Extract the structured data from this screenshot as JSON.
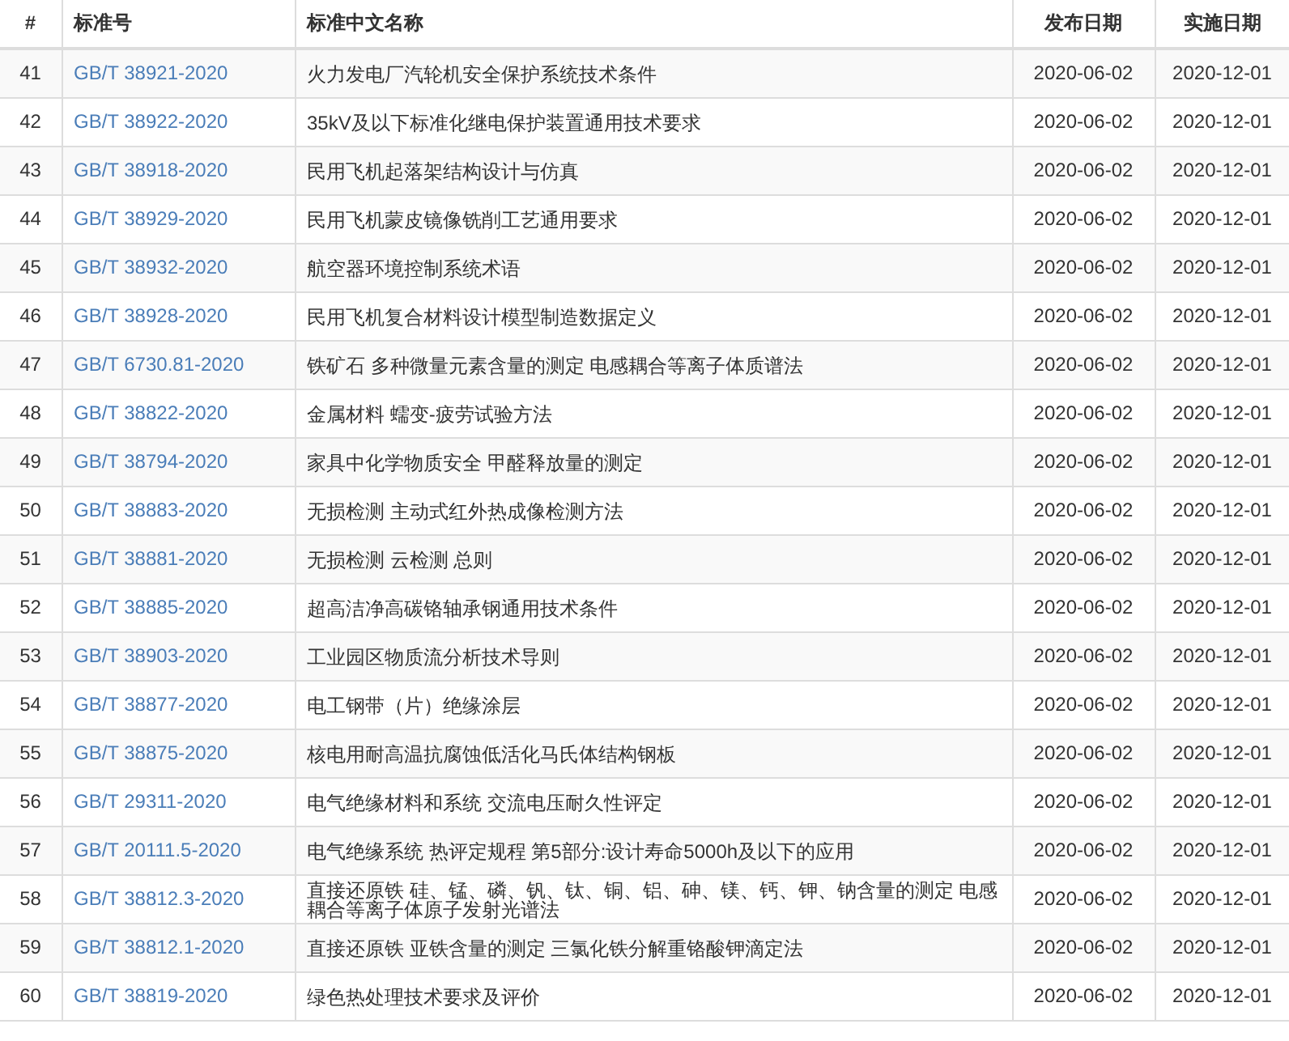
{
  "table": {
    "columns": [
      "#",
      "标准号",
      "标准中文名称",
      "发布日期",
      "实施日期"
    ],
    "rows": [
      {
        "index": "41",
        "code": "GB/T 38921-2020",
        "name": "火力发电厂汽轮机安全保护系统技术条件",
        "published": "2020-06-02",
        "effective": "2020-12-01"
      },
      {
        "index": "42",
        "code": "GB/T 38922-2020",
        "name": "35kV及以下标准化继电保护装置通用技术要求",
        "published": "2020-06-02",
        "effective": "2020-12-01"
      },
      {
        "index": "43",
        "code": "GB/T 38918-2020",
        "name": "民用飞机起落架结构设计与仿真",
        "published": "2020-06-02",
        "effective": "2020-12-01"
      },
      {
        "index": "44",
        "code": "GB/T 38929-2020",
        "name": "民用飞机蒙皮镜像铣削工艺通用要求",
        "published": "2020-06-02",
        "effective": "2020-12-01"
      },
      {
        "index": "45",
        "code": "GB/T 38932-2020",
        "name": "航空器环境控制系统术语",
        "published": "2020-06-02",
        "effective": "2020-12-01"
      },
      {
        "index": "46",
        "code": "GB/T 38928-2020",
        "name": "民用飞机复合材料设计模型制造数据定义",
        "published": "2020-06-02",
        "effective": "2020-12-01"
      },
      {
        "index": "47",
        "code": "GB/T 6730.81-2020",
        "name": "铁矿石 多种微量元素含量的测定 电感耦合等离子体质谱法",
        "published": "2020-06-02",
        "effective": "2020-12-01"
      },
      {
        "index": "48",
        "code": "GB/T 38822-2020",
        "name": "金属材料 蠕变-疲劳试验方法",
        "published": "2020-06-02",
        "effective": "2020-12-01"
      },
      {
        "index": "49",
        "code": "GB/T 38794-2020",
        "name": "家具中化学物质安全 甲醛释放量的测定",
        "published": "2020-06-02",
        "effective": "2020-12-01"
      },
      {
        "index": "50",
        "code": "GB/T 38883-2020",
        "name": "无损检测 主动式红外热成像检测方法",
        "published": "2020-06-02",
        "effective": "2020-12-01"
      },
      {
        "index": "51",
        "code": "GB/T 38881-2020",
        "name": "无损检测 云检测 总则",
        "published": "2020-06-02",
        "effective": "2020-12-01"
      },
      {
        "index": "52",
        "code": "GB/T 38885-2020",
        "name": "超高洁净高碳铬轴承钢通用技术条件",
        "published": "2020-06-02",
        "effective": "2020-12-01"
      },
      {
        "index": "53",
        "code": "GB/T 38903-2020",
        "name": "工业园区物质流分析技术导则",
        "published": "2020-06-02",
        "effective": "2020-12-01"
      },
      {
        "index": "54",
        "code": "GB/T 38877-2020",
        "name": "电工钢带（片）绝缘涂层",
        "published": "2020-06-02",
        "effective": "2020-12-01"
      },
      {
        "index": "55",
        "code": "GB/T 38875-2020",
        "name": "核电用耐高温抗腐蚀低活化马氏体结构钢板",
        "published": "2020-06-02",
        "effective": "2020-12-01"
      },
      {
        "index": "56",
        "code": "GB/T 29311-2020",
        "name": "电气绝缘材料和系统 交流电压耐久性评定",
        "published": "2020-06-02",
        "effective": "2020-12-01"
      },
      {
        "index": "57",
        "code": "GB/T 20111.5-2020",
        "name": "电气绝缘系统 热评定规程 第5部分:设计寿命5000h及以下的应用",
        "published": "2020-06-02",
        "effective": "2020-12-01"
      },
      {
        "index": "58",
        "code": "GB/T 38812.3-2020",
        "name": "直接还原铁 硅、锰、磷、钒、钛、铜、铝、砷、镁、钙、钾、钠含量的测定 电感耦合等离子体原子发射光谱法",
        "published": "2020-06-02",
        "effective": "2020-12-01"
      },
      {
        "index": "59",
        "code": "GB/T 38812.1-2020",
        "name": "直接还原铁 亚铁含量的测定 三氯化铁分解重铬酸钾滴定法",
        "published": "2020-06-02",
        "effective": "2020-12-01"
      },
      {
        "index": "60",
        "code": "GB/T 38819-2020",
        "name": "绿色热处理技术要求及评价",
        "published": "2020-06-02",
        "effective": "2020-12-01"
      }
    ]
  }
}
